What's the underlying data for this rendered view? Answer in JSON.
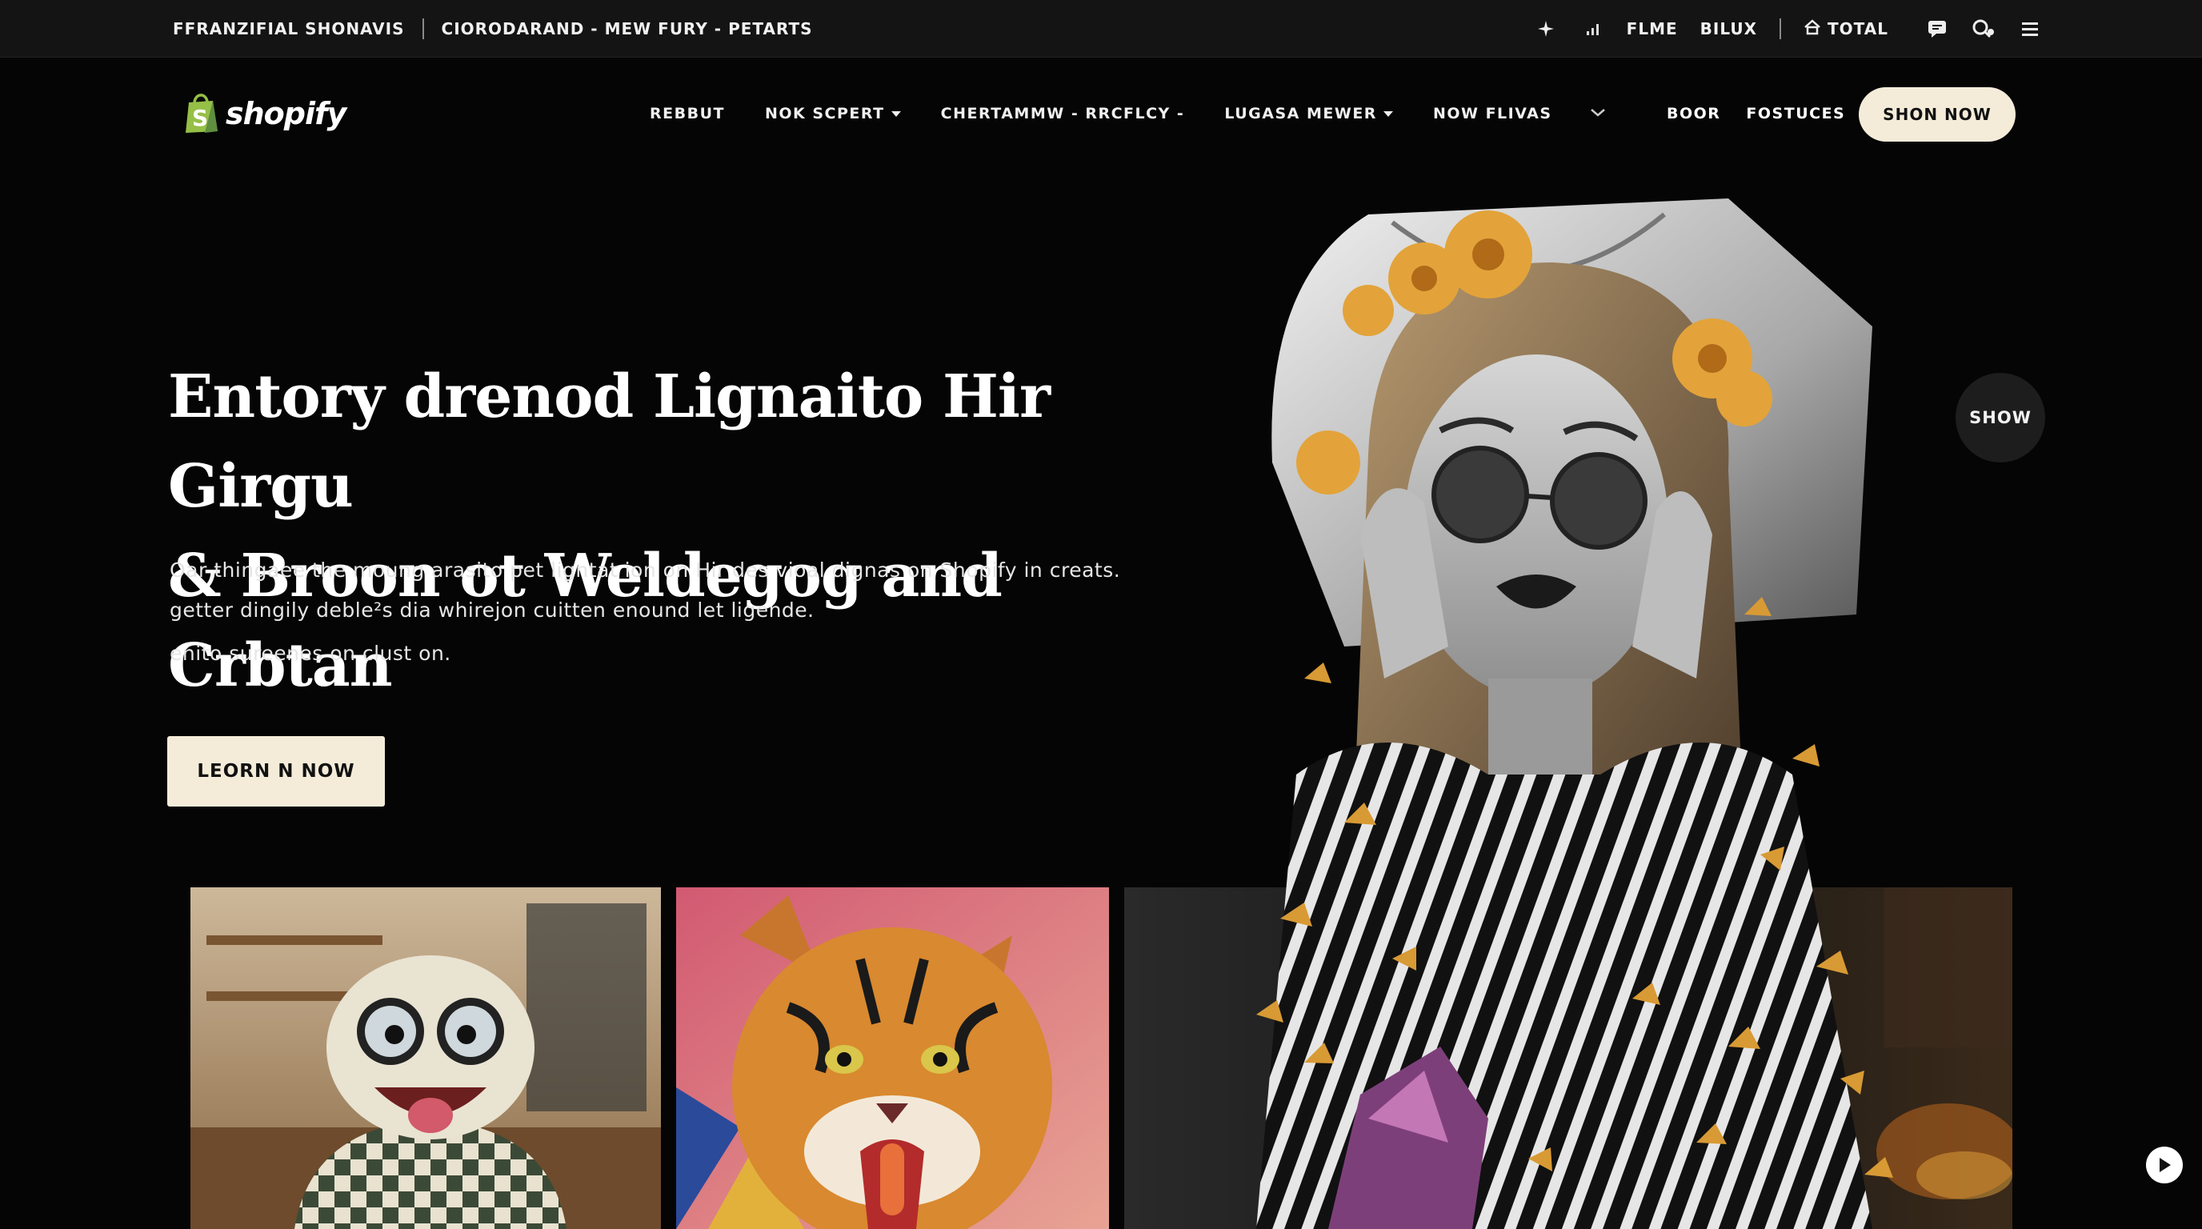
{
  "topbar": {
    "brand": "FFRANZIFIAL SHONAVIS",
    "breadcrumb": "CIORODARAND - MEW FURY - PETARTS",
    "links": [
      "FLME",
      "BILUX"
    ],
    "total_label": "TOTAL",
    "icons": [
      "sparkle-icon",
      "signal-icon",
      "home-icon",
      "chat-icon",
      "search-settings-icon",
      "menu-icon"
    ]
  },
  "nav": {
    "logo_text": "shopify",
    "links": [
      {
        "label": "REBBUT",
        "caret": false
      },
      {
        "label": "NOK SCPERT",
        "caret": true
      },
      {
        "label": "CHERTAMMW - RRCFLCY -",
        "caret": false
      },
      {
        "label": "LUGASA MEWER",
        "caret": true
      },
      {
        "label": "NOW FLIVAS",
        "caret": false
      }
    ],
    "right_links": [
      "BOOR",
      "FOSTUCES"
    ],
    "cta": "SHON NOW"
  },
  "hero": {
    "title_line1": "Entory drenod Lignaito Hir Girgu",
    "title_line2": "& Broon ot Weldegog and Crbtan",
    "paragraph_line1": "Oar thingaee the moung arasito pet ligntat ion on Hir des vioal dignas on Shopify in creats.",
    "paragraph_line2": "getter dingily deble²s dia whirejon cuitten enound let ligende.",
    "paragraph_line3": "enito sureenes on clust on.",
    "cta": "LEORN N NOW",
    "side_button": "SHOW"
  },
  "colors": {
    "background": "#050505",
    "topbar": "#141414",
    "cream_button": "#f4ecd9",
    "logo_green": "#95bf47",
    "gold_accent": "#e3a33a"
  }
}
